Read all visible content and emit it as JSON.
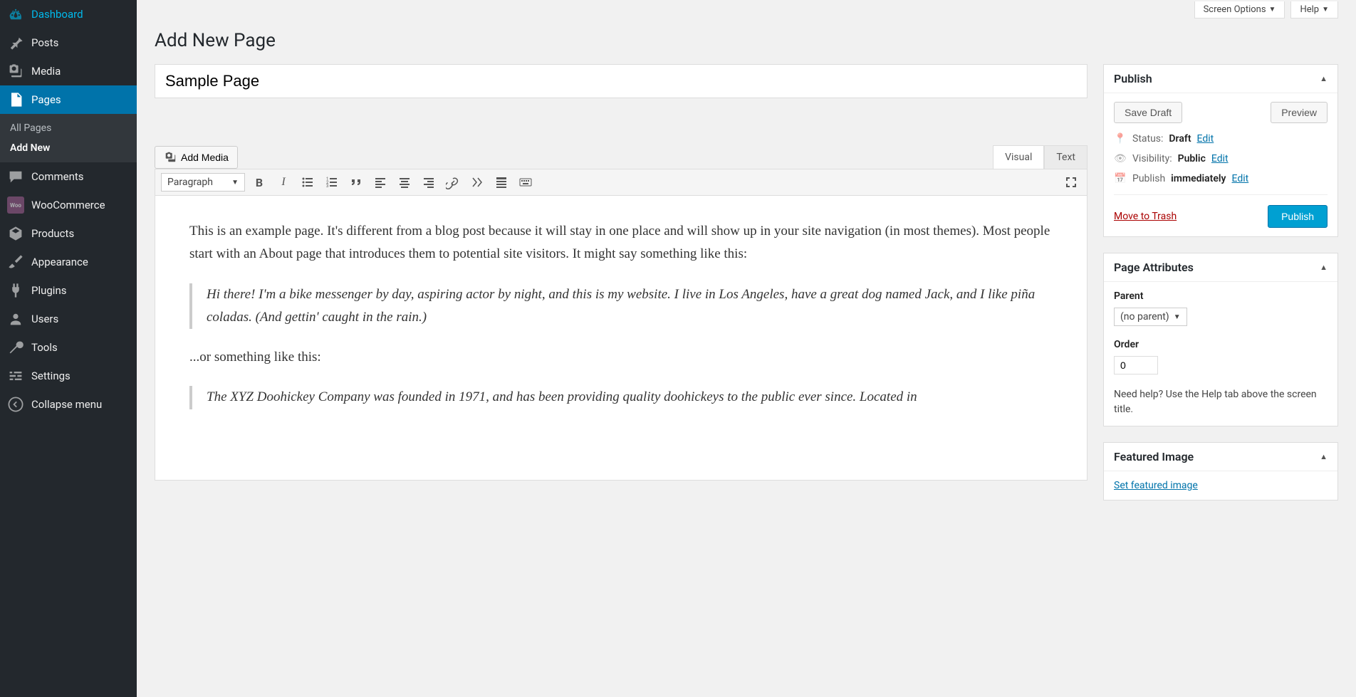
{
  "sidebar": {
    "items": [
      {
        "label": "Dashboard",
        "icon": "dashboard"
      },
      {
        "label": "Posts",
        "icon": "pin"
      },
      {
        "label": "Media",
        "icon": "media"
      },
      {
        "label": "Pages",
        "icon": "pages",
        "active": true
      },
      {
        "label": "Comments",
        "icon": "comment"
      },
      {
        "label": "WooCommerce",
        "icon": "woo"
      },
      {
        "label": "Products",
        "icon": "product"
      },
      {
        "label": "Appearance",
        "icon": "brush"
      },
      {
        "label": "Plugins",
        "icon": "plug"
      },
      {
        "label": "Users",
        "icon": "user"
      },
      {
        "label": "Tools",
        "icon": "wrench"
      },
      {
        "label": "Settings",
        "icon": "sliders"
      },
      {
        "label": "Collapse menu",
        "icon": "collapse"
      }
    ],
    "submenu": [
      {
        "label": "All Pages"
      },
      {
        "label": "Add New",
        "current": true
      }
    ]
  },
  "top_tabs": {
    "screen_options": "Screen Options",
    "help": "Help"
  },
  "page": {
    "heading": "Add New Page",
    "title_value": "Sample Page",
    "add_media": "Add Media",
    "tabs": {
      "visual": "Visual",
      "text": "Text"
    },
    "format_dropdown": "Paragraph",
    "content": {
      "p1": "This is an example page. It's different from a blog post because it will stay in one place and will show up in your site navigation (in most themes). Most people start with an About page that introduces them to potential site visitors. It might say something like this:",
      "bq1": "Hi there! I'm a bike messenger by day, aspiring actor by night, and this is my website. I live in Los Angeles, have a great dog named Jack, and I like piña coladas. (And gettin' caught in the rain.)",
      "p2": "...or something like this:",
      "bq2": "The XYZ Doohickey Company was founded in 1971, and has been providing quality doohickeys to the public ever since. Located in"
    }
  },
  "publish": {
    "title": "Publish",
    "save_draft": "Save Draft",
    "preview": "Preview",
    "status_label": "Status:",
    "status_value": "Draft",
    "visibility_label": "Visibility:",
    "visibility_value": "Public",
    "publish_label": "Publish",
    "publish_value": "immediately",
    "edit": "Edit",
    "trash": "Move to Trash",
    "submit": "Publish"
  },
  "attributes": {
    "title": "Page Attributes",
    "parent_label": "Parent",
    "parent_value": "(no parent)",
    "order_label": "Order",
    "order_value": "0",
    "help": "Need help? Use the Help tab above the screen title."
  },
  "featured": {
    "title": "Featured Image",
    "link": "Set featured image"
  }
}
